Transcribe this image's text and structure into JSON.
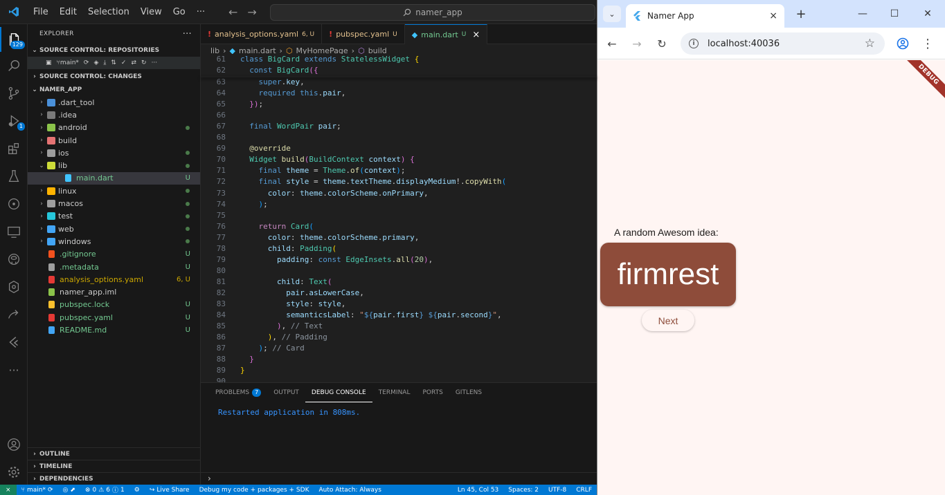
{
  "vscode": {
    "menu": [
      "File",
      "Edit",
      "Selection",
      "View",
      "Go",
      "···"
    ],
    "command_center": "namer_app",
    "activity_badges": {
      "source_control": "129",
      "run_debug": "1"
    },
    "explorer": {
      "title": "EXPLORER",
      "more": "···",
      "repositories_header": "SOURCE CONTROL: REPOSITORIES",
      "branch": "main*",
      "changes_header": "SOURCE CONTROL: CHANGES",
      "project_header": "NAMER_APP",
      "items": [
        {
          "label": ".dart_tool",
          "kind": "folder",
          "color": "#4a90d9",
          "status": "",
          "dot": false,
          "chev": "›",
          "indent": 0
        },
        {
          "label": ".idea",
          "kind": "folder",
          "color": "#7a7a7a",
          "status": "",
          "dot": false,
          "chev": "›",
          "indent": 0
        },
        {
          "label": "android",
          "kind": "folder",
          "color": "#8bc34a",
          "status": "",
          "dot": true,
          "chev": "›",
          "indent": 0
        },
        {
          "label": "build",
          "kind": "folder",
          "color": "#e57373",
          "status": "",
          "dot": false,
          "chev": "›",
          "indent": 0
        },
        {
          "label": "ios",
          "kind": "folder",
          "color": "#9e9e9e",
          "status": "",
          "dot": true,
          "chev": "›",
          "indent": 0
        },
        {
          "label": "lib",
          "kind": "folder",
          "color": "#cddc39",
          "status": "",
          "dot": true,
          "chev": "⌄",
          "indent": 0
        },
        {
          "label": "main.dart",
          "kind": "file",
          "color": "#40c4ff",
          "status": "U",
          "dot": false,
          "chev": "",
          "indent": 1
        },
        {
          "label": "linux",
          "kind": "folder",
          "color": "#ffb300",
          "status": "",
          "dot": true,
          "chev": "›",
          "indent": 0
        },
        {
          "label": "macos",
          "kind": "folder",
          "color": "#9e9e9e",
          "status": "",
          "dot": true,
          "chev": "›",
          "indent": 0
        },
        {
          "label": "test",
          "kind": "folder",
          "color": "#26c6da",
          "status": "",
          "dot": true,
          "chev": "›",
          "indent": 0
        },
        {
          "label": "web",
          "kind": "folder",
          "color": "#42a5f5",
          "status": "",
          "dot": true,
          "chev": "›",
          "indent": 0
        },
        {
          "label": "windows",
          "kind": "folder",
          "color": "#42a5f5",
          "status": "",
          "dot": true,
          "chev": "›",
          "indent": 0
        },
        {
          "label": ".gitignore",
          "kind": "file",
          "color": "#f4511e",
          "status": "U",
          "dot": false,
          "chev": "",
          "indent": 0
        },
        {
          "label": ".metadata",
          "kind": "file",
          "color": "#9e9e9e",
          "status": "U",
          "dot": false,
          "chev": "",
          "indent": 0
        },
        {
          "label": "analysis_options.yaml",
          "kind": "file",
          "color": "#e53935",
          "status": "6, U",
          "dot": false,
          "chev": "",
          "indent": 0
        },
        {
          "label": "namer_app.iml",
          "kind": "file",
          "color": "#8bc34a",
          "status": "",
          "dot": false,
          "chev": "",
          "indent": 0
        },
        {
          "label": "pubspec.lock",
          "kind": "file",
          "color": "#fbc02d",
          "status": "U",
          "dot": false,
          "chev": "",
          "indent": 0
        },
        {
          "label": "pubspec.yaml",
          "kind": "file",
          "color": "#e53935",
          "status": "U",
          "dot": false,
          "chev": "",
          "indent": 0
        },
        {
          "label": "README.md",
          "kind": "file",
          "color": "#42a5f5",
          "status": "U",
          "dot": false,
          "chev": "",
          "indent": 0
        }
      ],
      "outline": "OUTLINE",
      "timeline": "TIMELINE",
      "dependencies": "DEPENDENCIES"
    },
    "tabs": [
      {
        "label": "analysis_options.yaml",
        "status": "6, U",
        "color": "#e2c08d"
      },
      {
        "label": "pubspec.yaml",
        "status": "U",
        "color": "#e2c08d"
      },
      {
        "label": "main.dart",
        "status": "U",
        "color": "#73c991"
      }
    ],
    "tab_close": "×",
    "breadcrumb": [
      "lib",
      "main.dart",
      "MyHomePage",
      "build"
    ],
    "code_lines": [
      {
        "n": "61",
        "html": "<span class=\"k\">class</span> <span class=\"c\">BigCard</span> <span class=\"k\">extends</span> <span class=\"c\">StatelessWidget</span> <span class=\"gold\">{</span>"
      },
      {
        "n": "62",
        "html": "  <span class=\"k\">const</span> <span class=\"c\">BigCard</span><span class=\"pink\">({</span>"
      },
      {
        "n": "63",
        "html": "    <span class=\"k\">super</span>.<span class=\"v\">key</span>,"
      },
      {
        "n": "64",
        "html": "    <span class=\"k\">required</span> <span class=\"k\">this</span>.<span class=\"v\">pair</span>,"
      },
      {
        "n": "65",
        "html": "  <span class=\"pink\">})</span>;"
      },
      {
        "n": "66",
        "html": ""
      },
      {
        "n": "67",
        "html": "  <span class=\"k\">final</span> <span class=\"c\">WordPair</span> <span class=\"v\">pair</span>;"
      },
      {
        "n": "68",
        "html": ""
      },
      {
        "n": "69",
        "html": "  <span class=\"f\">@override</span>"
      },
      {
        "n": "70",
        "html": "  <span class=\"c\">Widget</span> <span class=\"f\">build</span><span class=\"pink\">(</span><span class=\"c\">BuildContext</span> <span class=\"v\">context</span><span class=\"pink\">)</span> <span class=\"pink\">{</span>"
      },
      {
        "n": "71",
        "html": "    <span class=\"k\">final</span> <span class=\"v\">theme</span> = <span class=\"c\">Theme</span>.<span class=\"f\">of</span><span class=\"blue\">(</span><span class=\"v\">context</span><span class=\"blue\">)</span>;"
      },
      {
        "n": "72",
        "html": "    <span class=\"k\">final</span> <span class=\"v\">style</span> = <span class=\"v\">theme</span>.<span class=\"v\">textTheme</span>.<span class=\"v\">displayMedium</span>!.<span class=\"f\">copyWith</span><span class=\"blue\">(</span>"
      },
      {
        "n": "73",
        "html": "      <span class=\"v\">color</span>: <span class=\"v\">theme</span>.<span class=\"v\">colorScheme</span>.<span class=\"v\">onPrimary</span>,"
      },
      {
        "n": "74",
        "html": "    <span class=\"blue\">)</span>;"
      },
      {
        "n": "75",
        "html": ""
      },
      {
        "n": "76",
        "html": "    <span class=\"kw2\">return</span> <span class=\"c\">Card</span><span class=\"blue\">(</span>"
      },
      {
        "n": "77",
        "html": "      <span class=\"v\">color</span>: <span class=\"v\">theme</span>.<span class=\"v\">colorScheme</span>.<span class=\"v\">primary</span>,"
      },
      {
        "n": "78",
        "html": "      <span class=\"v\">child</span>: <span class=\"c\">Padding</span><span class=\"gold\">(</span>"
      },
      {
        "n": "79",
        "html": "        <span class=\"v\">padding</span>: <span class=\"k\">const</span> <span class=\"c\">EdgeInsets</span>.<span class=\"f\">all</span><span class=\"pink\">(</span><span class=\"n\">20</span><span class=\"pink\">)</span>,"
      },
      {
        "n": "80",
        "html": ""
      },
      {
        "n": "81",
        "html": "        <span class=\"v\">child</span>: <span class=\"c\">Text</span><span class=\"pink\">(</span>"
      },
      {
        "n": "82",
        "html": "          <span class=\"v\">pair</span>.<span class=\"v\">asLowerCase</span>,"
      },
      {
        "n": "83",
        "html": "          <span class=\"v\">style</span>: <span class=\"v\">style</span>,"
      },
      {
        "n": "84",
        "html": "          <span class=\"v\">semanticsLabel</span>: <span class=\"s\">\"</span><span class=\"k\">${</span><span class=\"v\">pair</span>.<span class=\"v\">first</span><span class=\"k\">}</span> <span class=\"k\">${</span><span class=\"v\">pair</span>.<span class=\"v\">second</span><span class=\"k\">}</span><span class=\"s\">\"</span>,"
      },
      {
        "n": "85",
        "html": "        <span class=\"pink\">)</span>, <span class=\"cmt\">// Text</span>"
      },
      {
        "n": "86",
        "html": "      <span class=\"gold\">)</span>, <span class=\"cmt\">// Padding</span>"
      },
      {
        "n": "87",
        "html": "    <span class=\"blue\">)</span>; <span class=\"cmt\">// Card</span>"
      },
      {
        "n": "88",
        "html": "  <span class=\"pink\">}</span>"
      },
      {
        "n": "89",
        "html": "<span class=\"gold\">}</span>"
      },
      {
        "n": "90",
        "html": ""
      }
    ],
    "panel_tabs": [
      {
        "label": "PROBLEMS",
        "badge": "7"
      },
      {
        "label": "OUTPUT",
        "badge": ""
      },
      {
        "label": "DEBUG CONSOLE",
        "badge": ""
      },
      {
        "label": "TERMINAL",
        "badge": ""
      },
      {
        "label": "PORTS",
        "badge": ""
      },
      {
        "label": "GITLENS",
        "badge": ""
      }
    ],
    "console_text": "Restarted application in 808ms.",
    "panel_prompt": "›",
    "status": {
      "remote": "⨯",
      "branch": "main*",
      "errors": "0",
      "warnings": "6",
      "info": "1",
      "live_share": "Live Share",
      "debug": "Debug my code + packages + SDK",
      "auto_attach": "Auto Attach: Always",
      "position": "Ln 45, Col 53",
      "spaces": "Spaces: 2",
      "encoding": "UTF-8",
      "eol": "CRLF"
    }
  },
  "chrome": {
    "tab_title": "Namer App",
    "tab_close": "×",
    "new_tab": "+",
    "address": "localhost:40036",
    "info_glyph": "i",
    "app": {
      "debug_banner": "DEBUG",
      "label": "A random Awesom idea:",
      "word": "firmrest",
      "button": "Next"
    }
  }
}
